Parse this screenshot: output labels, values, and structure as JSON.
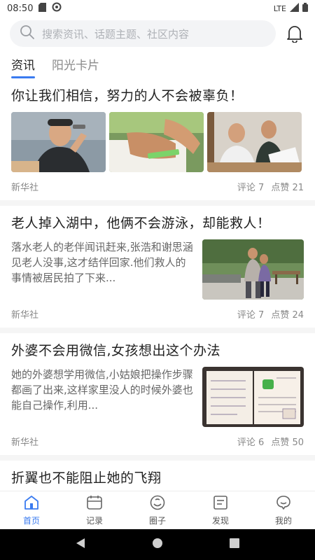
{
  "status_bar": {
    "time": "08:50",
    "network": "LTE"
  },
  "search": {
    "placeholder": "搜索资讯、话题主题、社区内容"
  },
  "tabs": [
    {
      "label": "资讯",
      "active": true
    },
    {
      "label": "阳光卡片",
      "active": false
    }
  ],
  "articles": [
    {
      "title": "你让我们相信，努力的人不会被辜负！",
      "source": "新华社",
      "comments": "评论 7",
      "likes": "点赞 21"
    },
    {
      "title": "老人掉入湖中，他俩不会游泳，却能救人！",
      "summary": "落水老人的老伴闻讯赶来,张浩和谢思涵见老人没事,这才结伴回家.他们救人的事情被居民拍了下来...",
      "source": "新华社",
      "comments": "评论 7",
      "likes": "点赞 24"
    },
    {
      "title": "外婆不会用微信,女孩想出这个办法",
      "summary": "她的外婆想学用微信,小姑娘把操作步骤都画了出来,这样家里没人的时候外婆也能自己操作,利用...",
      "source": "新华社",
      "comments": "评论 6",
      "likes": "点赞 50"
    },
    {
      "title": "折翼也不能阻止她的飞翔"
    }
  ],
  "bottom_nav": [
    {
      "label": "首页",
      "icon": "home-icon",
      "active": true
    },
    {
      "label": "记录",
      "icon": "calendar-icon",
      "active": false
    },
    {
      "label": "圈子",
      "icon": "circle-icon",
      "active": false
    },
    {
      "label": "发现",
      "icon": "discover-icon",
      "active": false
    },
    {
      "label": "我的",
      "icon": "profile-icon",
      "active": false
    }
  ],
  "colors": {
    "accent": "#3a7bf0",
    "text": "#222222",
    "muted": "#888888"
  }
}
